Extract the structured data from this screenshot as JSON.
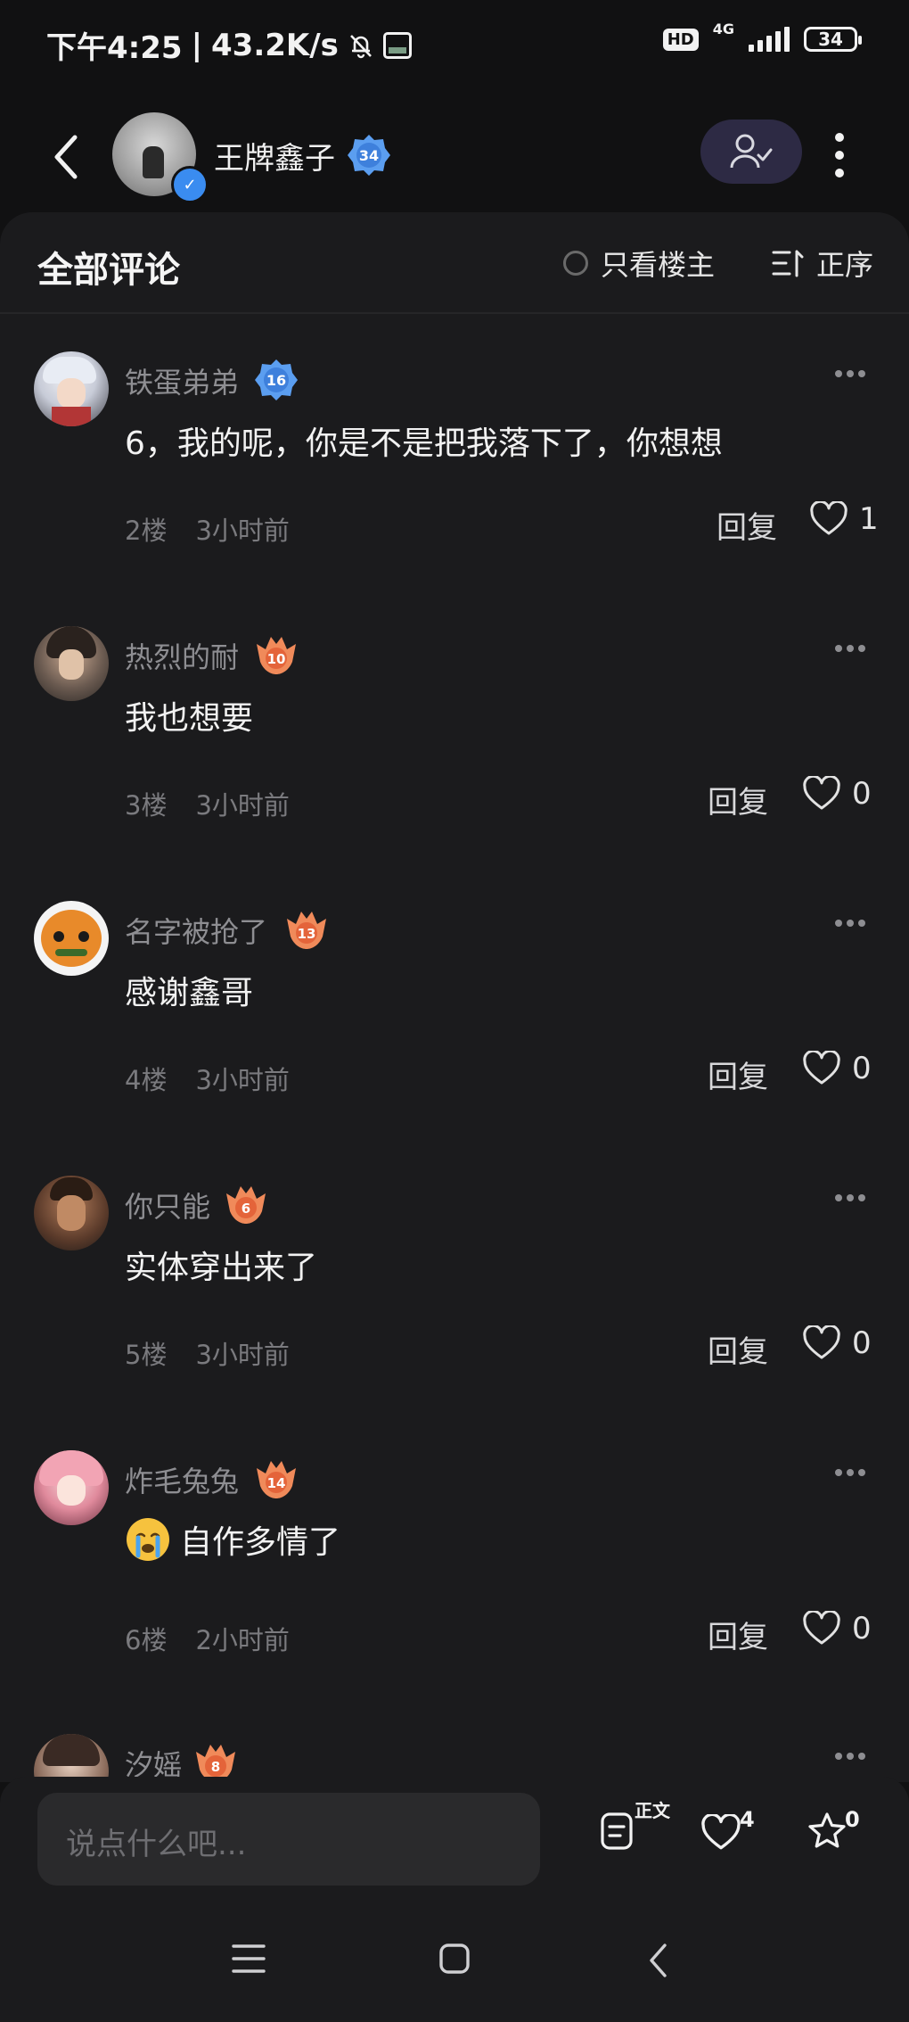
{
  "status_bar": {
    "time": "下午4:25",
    "speed": "43.2K/s",
    "hd": "HD",
    "network": "4G",
    "battery": "34"
  },
  "header": {
    "username": "王牌鑫子",
    "level": "34"
  },
  "comments_panel": {
    "title": "全部评论",
    "only_host": "只看楼主",
    "sort": "正序",
    "reply_label": "回复",
    "comments": [
      {
        "name": "铁蛋弟弟",
        "level": "16",
        "text": "6，我的呢，你是不是把我落下了，你想想",
        "floor": "2楼",
        "time": "3小时前",
        "likes": "1"
      },
      {
        "name": "热烈的耐",
        "level": "10",
        "text": "我也想要",
        "floor": "3楼",
        "time": "3小时前",
        "likes": "0"
      },
      {
        "name": "名字被抢了",
        "level": "13",
        "text": "感谢鑫哥",
        "floor": "4楼",
        "time": "3小时前",
        "likes": "0"
      },
      {
        "name": "你只能",
        "level": "6",
        "text": "实体穿出来了",
        "floor": "5楼",
        "time": "3小时前",
        "likes": "0"
      },
      {
        "name": "炸毛兔兔",
        "level": "14",
        "text": "自作多情了",
        "floor": "6楼",
        "time": "2小时前",
        "likes": "0"
      },
      {
        "name": "汐媱",
        "level": "8"
      }
    ]
  },
  "input_bar": {
    "placeholder": "说点什么吧...",
    "doc_label": "正文",
    "like_count": "4",
    "star_count": "0"
  },
  "colors": {
    "background": "#111112",
    "panel": "#1b1b1d",
    "level_blue": "#5b9ef0",
    "level_orange": "#f08a5a",
    "verified": "#3a8cf0"
  }
}
